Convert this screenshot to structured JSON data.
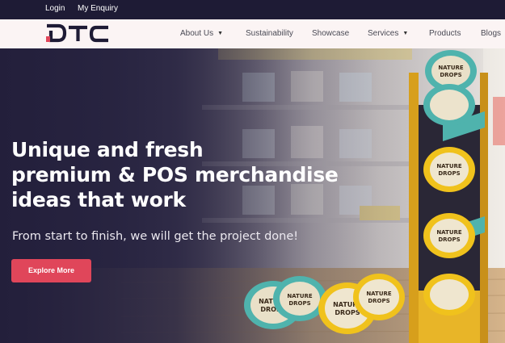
{
  "topbar": {
    "login": "Login",
    "enquiry": "My Enquiry"
  },
  "brand": {
    "logo_text": "DTC",
    "accent": "#e0465a",
    "dark": "#1e1b35"
  },
  "nav": [
    {
      "label": "About Us",
      "dropdown": true
    },
    {
      "label": "Sustainability",
      "dropdown": false
    },
    {
      "label": "Showcase",
      "dropdown": false
    },
    {
      "label": "Services",
      "dropdown": true
    },
    {
      "label": "Products",
      "dropdown": false
    },
    {
      "label": "Blogs",
      "dropdown": false
    }
  ],
  "hero": {
    "headline": [
      "Unique and fresh",
      "premium & POS merchandise",
      "ideas that work"
    ],
    "subline": "From start to finish, we will get the project done!",
    "cta": "Explore More",
    "product": {
      "name_top": "NATURE",
      "name_bottom": "DROPS"
    }
  }
}
